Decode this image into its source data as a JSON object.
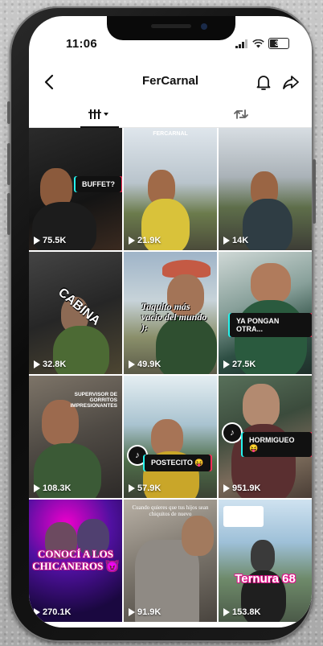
{
  "status": {
    "time": "11:06",
    "battery": "31"
  },
  "header": {
    "title": "FerCarnal"
  },
  "colors": {
    "accent_cyan": "#25f4ee",
    "accent_red": "#fe2c55"
  },
  "tabs": [
    {
      "icon": "grid-icon",
      "active": true
    },
    {
      "icon": "repost-icon",
      "active": false
    }
  ],
  "videos": [
    {
      "views": "75.5K",
      "caption": "BUFFET?"
    },
    {
      "views": "21.9K",
      "caption": "FERCARNAL"
    },
    {
      "views": "14K",
      "caption": ""
    },
    {
      "views": "32.8K",
      "caption": "CABINA"
    },
    {
      "views": "49.9K",
      "caption": "Taquito más vacío del mundo ):"
    },
    {
      "views": "27.5K",
      "caption": "YA PONGAN OTRA..."
    },
    {
      "views": "108.3K",
      "caption": "SUPERVISOR DE GORRITOS IMPRESIONANTES"
    },
    {
      "views": "57.9K",
      "caption": "POSTECITO 😝"
    },
    {
      "views": "951.9K",
      "caption": "HORMIGUEO 😝"
    },
    {
      "views": "270.1K",
      "caption": "CONOCÍ A LOS CHICANEROS 😈"
    },
    {
      "views": "91.9K",
      "caption": "Cuando quieres que tus hijos sean chiquitos de nuevo"
    },
    {
      "views": "153.8K",
      "caption": "Ternura 68"
    }
  ]
}
